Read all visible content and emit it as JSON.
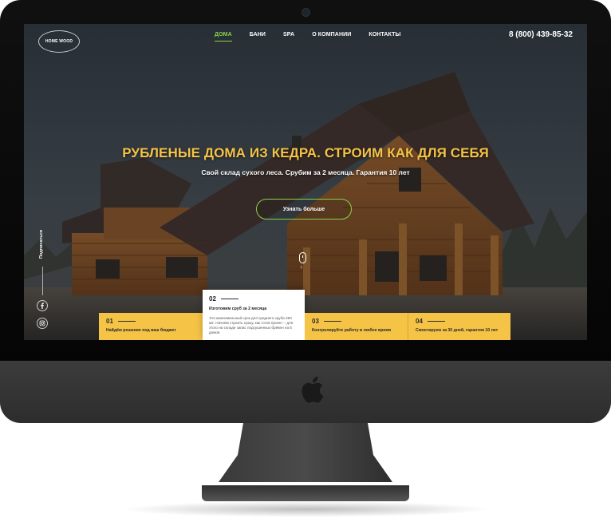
{
  "brand": {
    "logo_text": "HOME WOOD"
  },
  "nav": {
    "items": [
      {
        "label": "ДОМА",
        "active": true
      },
      {
        "label": "БАНИ",
        "active": false
      },
      {
        "label": "SPA",
        "active": false
      },
      {
        "label": "О КОМПАНИИ",
        "active": false
      },
      {
        "label": "КОНТАКТЫ",
        "active": false
      }
    ],
    "active_color": "#8bd14a"
  },
  "header": {
    "phone": "8 (800) 439-85-32"
  },
  "hero": {
    "title": "РУБЛЕНЫЕ ДОМА ИЗ КЕДРА. СТРОИМ КАК ДЛЯ СЕБЯ",
    "subtitle": "Свой склад сухого леса. Срубим за 2 месяца. Гарантия 10 лет",
    "cta_label": "Узнать больше",
    "title_color": "#f5c346"
  },
  "social": {
    "subscribe_label": "Подписаться",
    "icons": [
      "facebook-icon",
      "instagram-icon"
    ]
  },
  "features": [
    {
      "num": "01",
      "text": "Найдём решение под ваш бюджет"
    },
    {
      "num": "02",
      "text": "Изготовим сруб за 2 месяца",
      "desc": "Это максимальный срок для среднего сруба 250 м2. Начнём строить сразу, как готов проект – для этого на складе запас подсушенных брёвен на 5 домов"
    },
    {
      "num": "03",
      "text": "Контролируйте работу в любое время"
    },
    {
      "num": "04",
      "text": "Смонтируем за 30 дней, гарантия 10 лет"
    }
  ],
  "feature_strip_color": "#f5c346"
}
